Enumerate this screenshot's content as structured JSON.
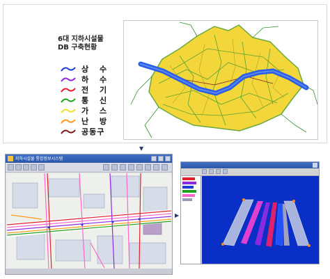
{
  "legend": {
    "title_line1": "6대 지하시설물",
    "title_line2": "DB 구축현황",
    "items": [
      {
        "label": "상 수",
        "color": "#1c3cd8"
      },
      {
        "label": "하 수",
        "color": "#8a2be2"
      },
      {
        "label": "전 기",
        "color": "#e0202a"
      },
      {
        "label": "통 신",
        "color": "#20a020"
      },
      {
        "label": "가 스",
        "color": "#f0e030"
      },
      {
        "label": "난 방",
        "color": "#ff9a1a"
      },
      {
        "label": "공동구",
        "color": "#7a1a1a"
      }
    ]
  },
  "gis_window": {
    "title": "지하시설물 통합정보시스템"
  },
  "colors": {
    "river": "#2a5ee6",
    "urban": "#e8c020",
    "scene_bg": "#0a2fc6",
    "window_title": "#2c57a8"
  },
  "icons": {
    "down_arrow": "arrow-down-icon",
    "right_arrow": "arrow-right-icon"
  }
}
